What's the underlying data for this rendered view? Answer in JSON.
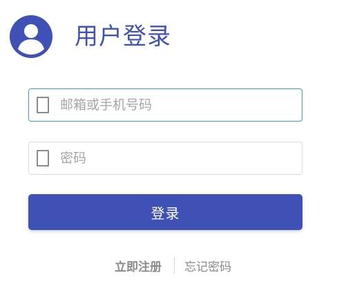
{
  "header": {
    "avatar_icon": "user-avatar-icon",
    "title": "用户登录"
  },
  "colors": {
    "primary": "#3f51b5",
    "focus_border": "#3d9ad6",
    "muted_text": "#888888"
  },
  "form": {
    "account": {
      "icon": "phone-icon",
      "placeholder": "邮箱或手机号码",
      "value": ""
    },
    "password": {
      "icon": "phone-icon",
      "placeholder": "密码",
      "value": ""
    },
    "submit_label": "登录"
  },
  "links": {
    "register": "立即注册",
    "forgot": "忘记密码"
  }
}
